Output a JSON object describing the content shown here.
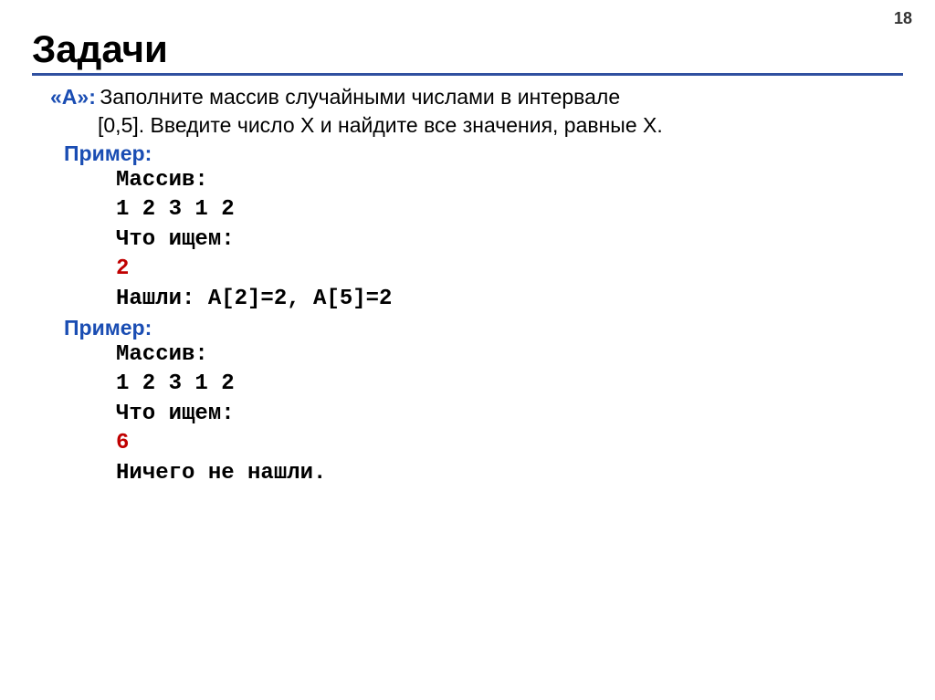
{
  "page_number": "18",
  "title": "Задачи",
  "task": {
    "label": "«A»:",
    "text1": " Заполните массив случайными числами в интервале",
    "text2": "[0,5]. Введите число X и найдите все значения, равные X."
  },
  "example1": {
    "label": "Пример:",
    "line1": "Массив:",
    "line2": "1 2 3 1 2",
    "line3": "Что ищем:",
    "line4": "2",
    "line5": "Нашли: A[2]=2, A[5]=2"
  },
  "example2": {
    "label": "Пример:",
    "line1": "Массив:",
    "line2": "1 2 3 1 2",
    "line3": "Что ищем:",
    "line4": "6",
    "line5": "Ничего не нашли."
  }
}
